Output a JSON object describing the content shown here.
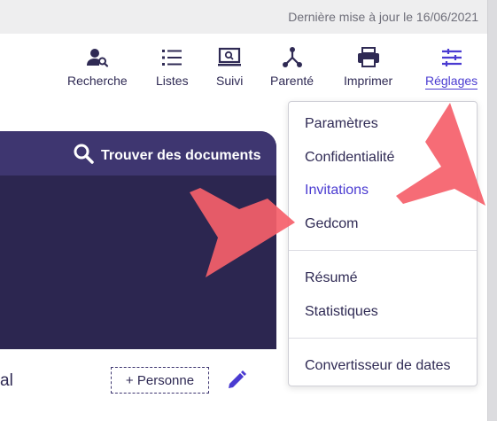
{
  "update_notice": "Dernière mise à jour le 16/06/2021",
  "toolbar": {
    "items": [
      {
        "label": "Recherche",
        "icon": "person-search-icon"
      },
      {
        "label": "Listes",
        "icon": "list-icon"
      },
      {
        "label": "Suivi",
        "icon": "monitor-search-icon"
      },
      {
        "label": "Parenté",
        "icon": "relationship-icon"
      },
      {
        "label": "Imprimer",
        "icon": "printer-icon"
      },
      {
        "label": "Réglages",
        "icon": "sliders-icon"
      }
    ],
    "active": "Réglages"
  },
  "hero": {
    "find_label": "Trouver des documents"
  },
  "lower": {
    "fragment": "al",
    "add_person_label": "+ Personne"
  },
  "menu": {
    "group1": [
      "Paramètres",
      "Confidentialité",
      "Invitations",
      "Gedcom"
    ],
    "group2": [
      "Résumé",
      "Statistiques"
    ],
    "group3": [
      "Convertisseur de dates"
    ],
    "highlighted": "Invitations"
  },
  "colors": {
    "accent": "#4a3bd1",
    "dark_navy": "#2c2650",
    "arrow": "#f5606a"
  }
}
